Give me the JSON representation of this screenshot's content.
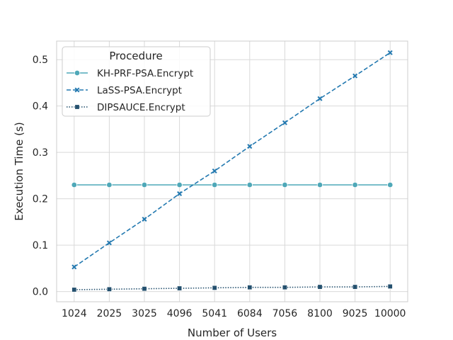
{
  "chart_data": {
    "type": "line",
    "title": "",
    "xlabel": "Number of Users",
    "ylabel": "Execution Time (s)",
    "x": [
      1024,
      2025,
      3025,
      4096,
      5041,
      6084,
      7056,
      8100,
      9025,
      10000
    ],
    "xticks": [
      "1024",
      "2025",
      "3025",
      "4096",
      "5041",
      "6084",
      "7056",
      "8100",
      "9025",
      "10000"
    ],
    "yticks": [
      "0.0",
      "0.1",
      "0.2",
      "0.3",
      "0.4",
      "0.5"
    ],
    "ylim": [
      -0.022,
      0.54
    ],
    "grid": true,
    "legend": {
      "title": "Procedure",
      "placement": "upper-left"
    },
    "series": [
      {
        "name": "KH-PRF-PSA.Encrypt",
        "color": "#4fa8b8",
        "linestyle": "solid",
        "marker": "circle",
        "values": [
          0.23,
          0.23,
          0.23,
          0.23,
          0.23,
          0.23,
          0.23,
          0.23,
          0.23,
          0.23
        ]
      },
      {
        "name": "LaSS-PSA.Encrypt",
        "color": "#2379b0",
        "linestyle": "dashed",
        "marker": "x",
        "values": [
          0.053,
          0.105,
          0.156,
          0.211,
          0.26,
          0.313,
          0.364,
          0.416,
          0.465,
          0.515
        ]
      },
      {
        "name": "DIPSAUCE.Encrypt",
        "color": "#24506e",
        "linestyle": "dotted",
        "marker": "square",
        "values": [
          0.004,
          0.005,
          0.006,
          0.007,
          0.008,
          0.009,
          0.009,
          0.01,
          0.01,
          0.011
        ]
      }
    ]
  }
}
